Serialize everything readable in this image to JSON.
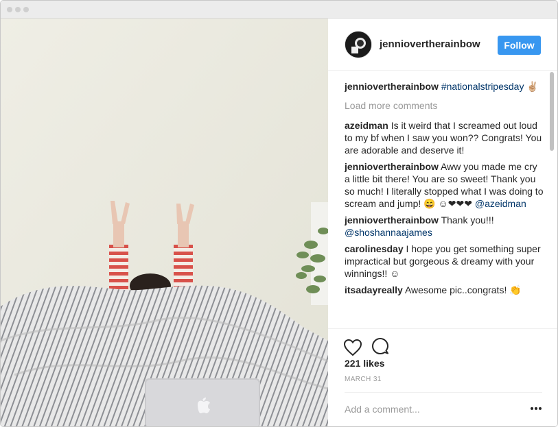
{
  "window": {
    "title": ""
  },
  "post": {
    "author": "jenniovertherainbow",
    "follow_label": "Follow",
    "caption": {
      "user": "jenniovertherainbow",
      "hashtag": "#nationalstripesday",
      "tail": "✌🏼"
    },
    "load_more": "Load more comments",
    "comments": [
      {
        "user": "azeidman",
        "text": "Is it weird that I screamed out loud to my bf when I saw you won?? Congrats! You are adorable and deserve it!"
      },
      {
        "user": "jenniovertherainbow",
        "text": "Aww you made me cry a little bit there! You are so sweet! Thank you so much! I literally stopped what I was doing to scream and jump! 😄 ☺❤❤❤",
        "mention": "@azeidman"
      },
      {
        "user": "jenniovertherainbow",
        "text": "Thank you!!!",
        "mention": "@shoshannaajames"
      },
      {
        "user": "carolinesday",
        "text": "I hope you get something super impractical but gorgeous & dreamy with your winnings!! ☺"
      },
      {
        "user": "itsadayreally",
        "text": "Awesome pic..congrats! 👏"
      }
    ],
    "likes": "221 likes",
    "date": "MARCH 31",
    "add_comment_placeholder": "Add a comment..."
  },
  "icons": {
    "heart": "heart-icon",
    "comment": "comment-icon",
    "more": "more-options-icon"
  },
  "colors": {
    "follow_button": "#3897f0",
    "link": "#003569",
    "muted": "#999999"
  }
}
